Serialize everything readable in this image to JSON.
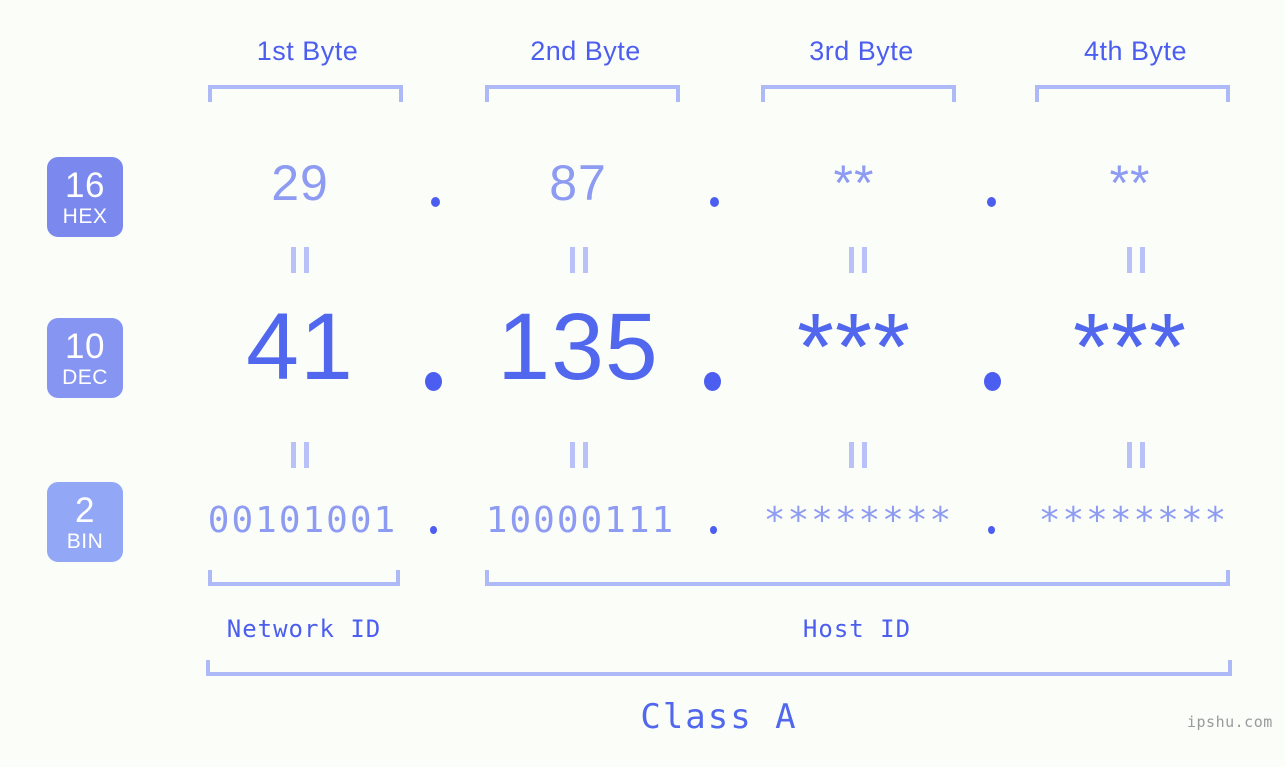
{
  "headers": [
    {
      "label": "1st Byte"
    },
    {
      "label": "2nd Byte"
    },
    {
      "label": "3rd Byte"
    },
    {
      "label": "4th Byte"
    }
  ],
  "rows": [
    {
      "badge_number": "16",
      "badge_abbr": "HEX",
      "badge_color": "#7b88ee",
      "values": [
        "29",
        "87",
        "**",
        "**"
      ],
      "separator": "."
    },
    {
      "badge_number": "10",
      "badge_abbr": "DEC",
      "badge_color": "#8795f2",
      "values": [
        "41",
        "135",
        "***",
        "***"
      ],
      "separator": "."
    },
    {
      "badge_number": "2",
      "badge_abbr": "BIN",
      "badge_color": "#92a8f7",
      "values": [
        "00101001",
        "10000111",
        "********",
        "********"
      ],
      "separator": "."
    }
  ],
  "equality_marker": "||",
  "segments": {
    "network_id": "Network ID",
    "host_id": "Host ID"
  },
  "class_label": "Class A",
  "watermark": "ipshu.com",
  "colors": {
    "background": "#fbfdf8",
    "accent_text": "#4c5ef0",
    "value_light": "#8d9bf2",
    "value_strong": "#5067ee",
    "bracket": "#aeb9f7",
    "badge_text": "#ffffff"
  }
}
